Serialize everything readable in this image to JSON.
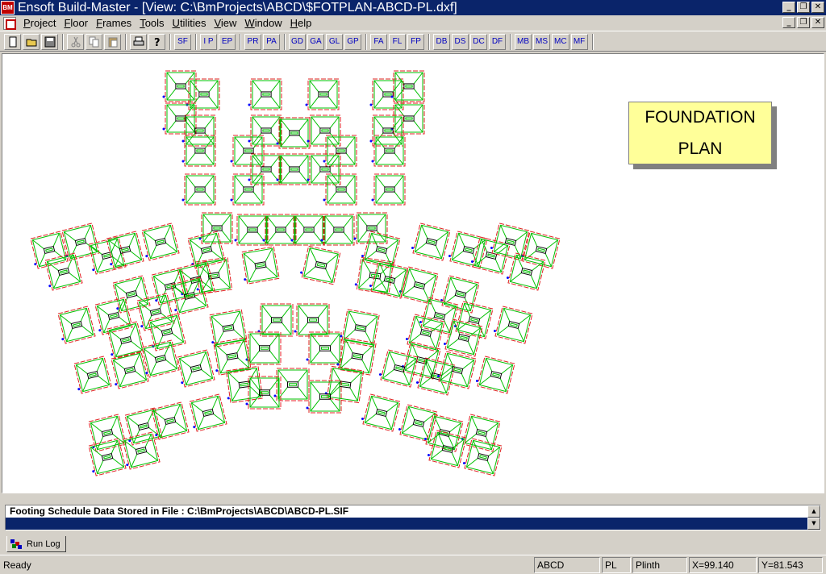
{
  "window": {
    "app_icon_text": "BM",
    "title": "Ensoft Build-Master - [View: C:\\BmProjects\\ABCD\\$FOTPLAN-ABCD-PL.dxf]",
    "minimize_glyph": "_",
    "maximize_glyph": "❐",
    "close_glyph": "✕"
  },
  "menu": {
    "items": [
      {
        "key": "P",
        "rest": "roject"
      },
      {
        "key": "F",
        "rest": "loor"
      },
      {
        "key": "F",
        "rest": "rames"
      },
      {
        "key": "T",
        "rest": "ools"
      },
      {
        "key": "U",
        "rest": "tilities"
      },
      {
        "key": "V",
        "rest": "iew"
      },
      {
        "key": "W",
        "rest": "indow"
      },
      {
        "key": "H",
        "rest": "elp"
      }
    ]
  },
  "toolbar": {
    "icons": [
      "new-file-icon",
      "open-folder-icon",
      "save-icon",
      "cut-icon",
      "copy-icon",
      "paste-icon",
      "print-icon",
      "help-icon"
    ],
    "groups": [
      [
        "SF"
      ],
      [
        "I P",
        "EP"
      ],
      [
        "PR",
        "PA"
      ],
      [
        "GD",
        "GA",
        "GL",
        "GP"
      ],
      [
        "FA",
        "FL",
        "FP"
      ],
      [
        "DB",
        "DS",
        "DC",
        "DF"
      ],
      [
        "MB",
        "MS",
        "MC",
        "MF"
      ]
    ]
  },
  "drawing": {
    "label_line1": "FOUNDATION",
    "label_line2": "PLAN",
    "colors": {
      "footing_outline": "#e02020",
      "footing_inner": "#00c000",
      "column": "#000000",
      "marker": "#0000ff"
    }
  },
  "log": {
    "lines": [
      "Footing Schedule Data Stored in File : C:\\BmProjects\\ABCD\\ABCD-PL.SIF",
      ""
    ],
    "tab_label": "Run Log"
  },
  "status": {
    "message": "Ready",
    "project": "ABCD",
    "floor": "PL",
    "floor_name": "Plinth",
    "x": "X=99.140",
    "y": "Y=81.543"
  }
}
